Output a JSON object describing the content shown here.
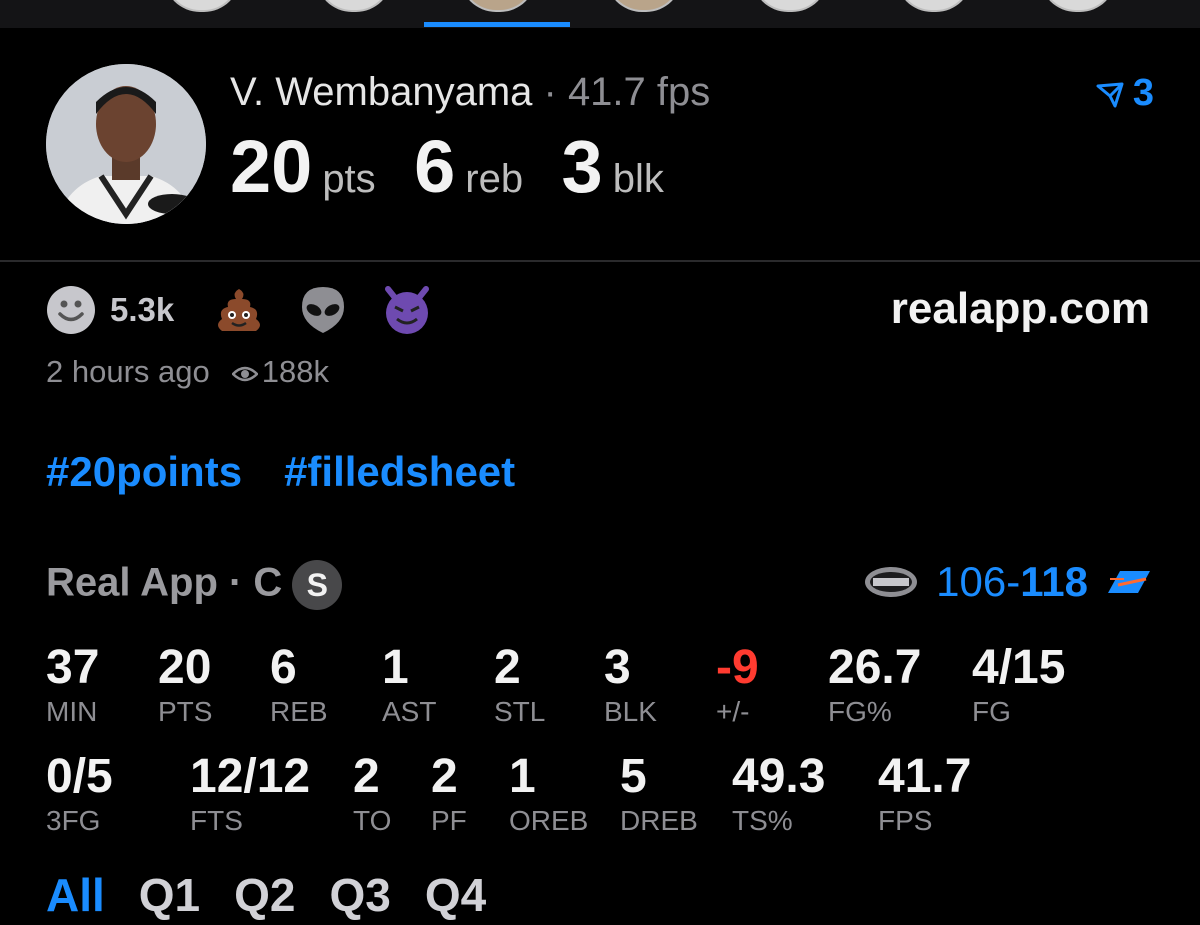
{
  "player": {
    "name": "V. Wembanyama",
    "fps_label": " · 41.7 fps",
    "stats": [
      {
        "num": "20",
        "unit": "pts"
      },
      {
        "num": "6",
        "unit": "reb"
      },
      {
        "num": "3",
        "unit": "blk"
      }
    ],
    "share_count": "3"
  },
  "reactions": {
    "smile_count": "5.3k",
    "icons": [
      "smile-icon",
      "poop-icon",
      "alien-icon",
      "devil-icon"
    ]
  },
  "site": "realapp.com",
  "meta": {
    "time": "2 hours ago",
    "views": "188k"
  },
  "hashtags": [
    "#20points",
    "#filledsheet"
  ],
  "game": {
    "label": "Real App · C",
    "badge": "S",
    "score_left": "106-",
    "score_right": "118",
    "team_left_logo": "spurs-logo",
    "team_right_logo": "okc-logo"
  },
  "stats_row1": [
    {
      "value": "37",
      "label": "MIN"
    },
    {
      "value": "20",
      "label": "PTS"
    },
    {
      "value": "6",
      "label": "REB"
    },
    {
      "value": "1",
      "label": "AST"
    },
    {
      "value": "2",
      "label": "STL"
    },
    {
      "value": "3",
      "label": "BLK"
    },
    {
      "value": "-9",
      "label": "+/-"
    },
    {
      "value": "26.7",
      "label": "FG%"
    },
    {
      "value": "4/15",
      "label": "FG"
    }
  ],
  "stats_row2": [
    {
      "value": "0/5",
      "label": "3FG"
    },
    {
      "value": "12/12",
      "label": "FTS"
    },
    {
      "value": "2",
      "label": "TO"
    },
    {
      "value": "2",
      "label": "PF"
    },
    {
      "value": "1",
      "label": "OREB"
    },
    {
      "value": "5",
      "label": "DREB"
    },
    {
      "value": "49.3",
      "label": "TS%"
    },
    {
      "value": "41.7",
      "label": "FPS"
    }
  ],
  "periods": [
    "All",
    "Q1",
    "Q2",
    "Q3",
    "Q4"
  ],
  "colors": {
    "accent": "#1a8cff",
    "negative": "#ff3b30",
    "background": "#000000"
  }
}
